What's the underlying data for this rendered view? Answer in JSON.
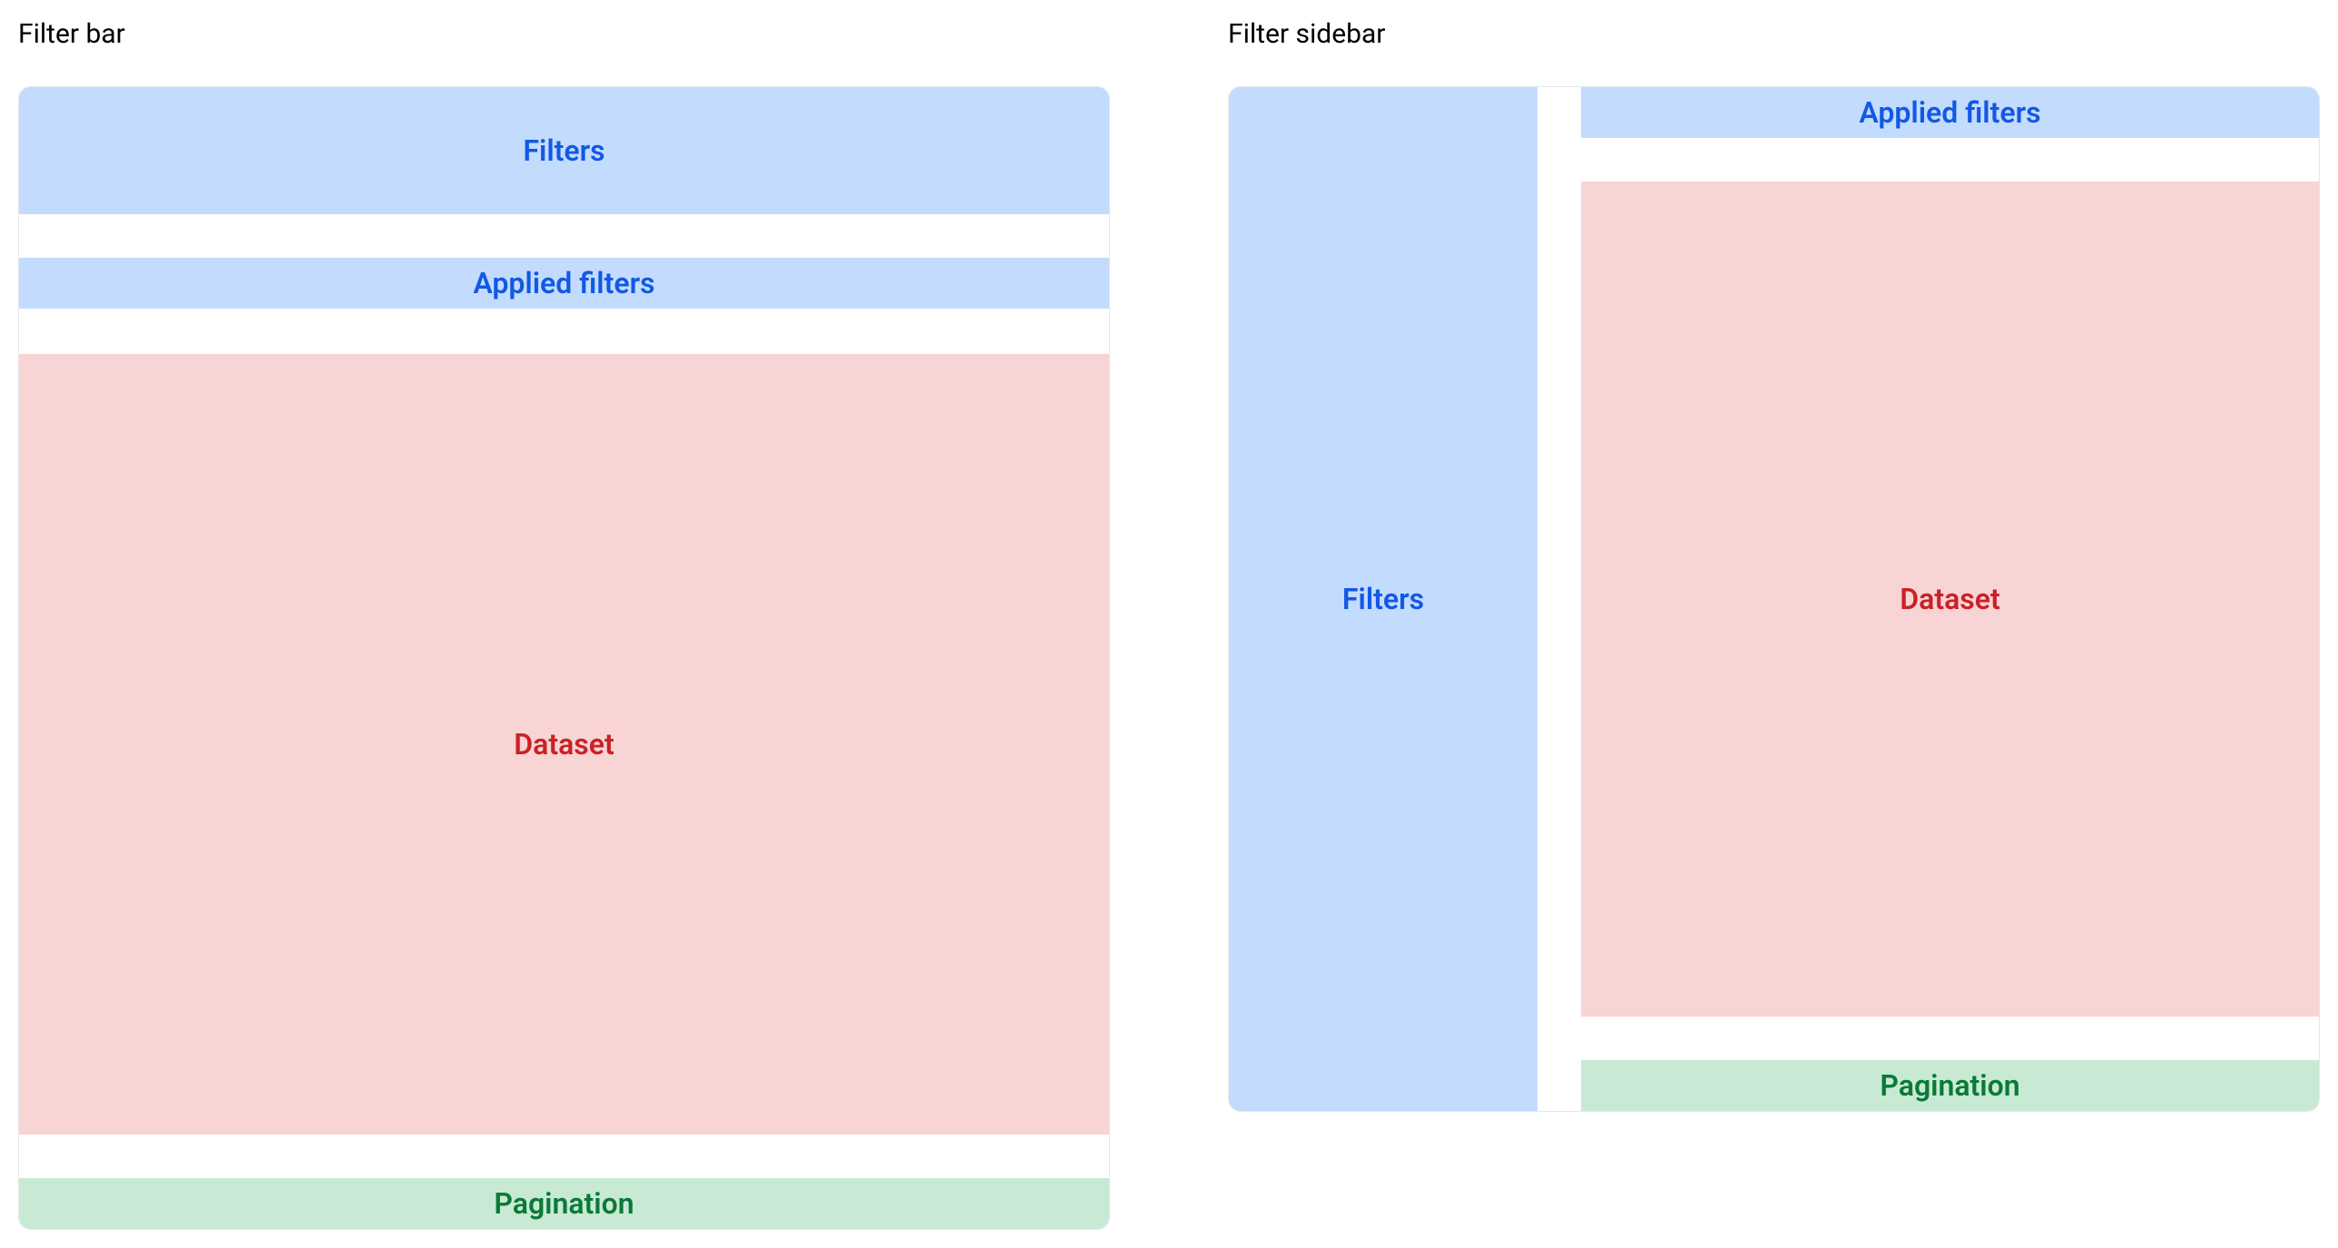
{
  "left": {
    "title": "Filter bar",
    "filters": "Filters",
    "applied": "Applied filters",
    "dataset": "Dataset",
    "pagination": "Pagination"
  },
  "right": {
    "title": "Filter sidebar",
    "filters": "Filters",
    "applied": "Applied filters",
    "dataset": "Dataset",
    "pagination": "Pagination"
  }
}
